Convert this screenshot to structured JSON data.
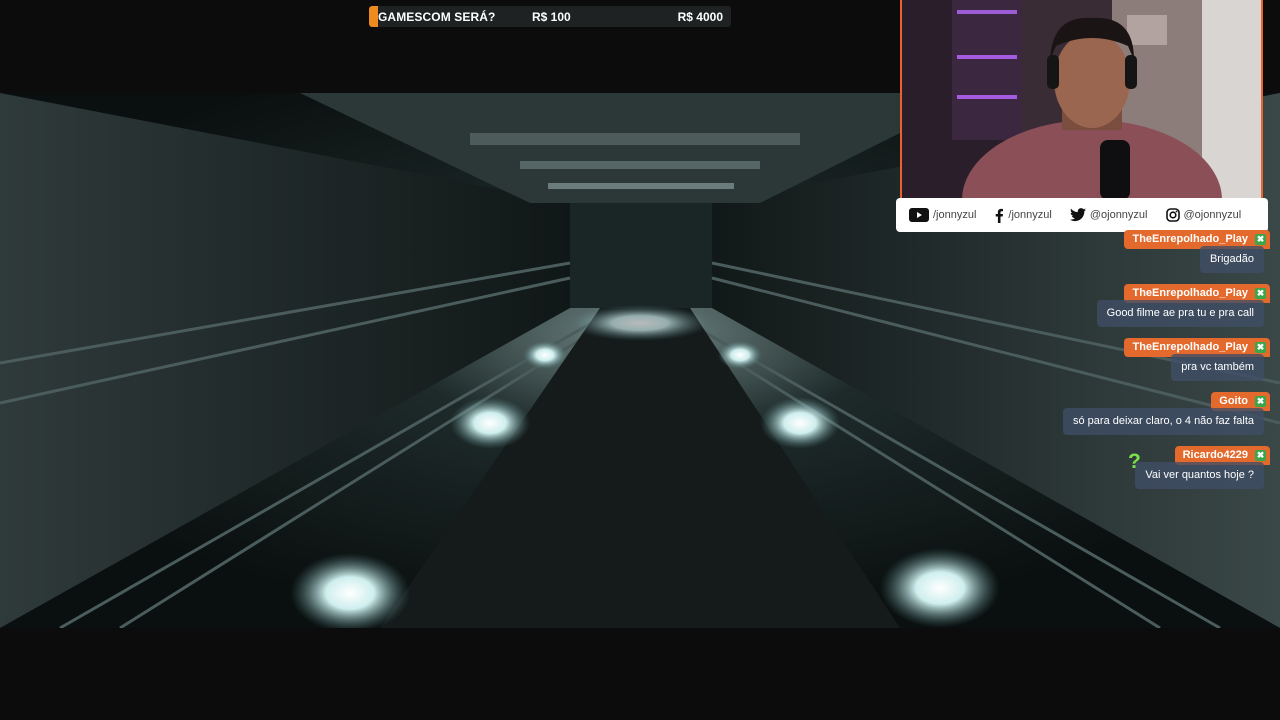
{
  "goal": {
    "title": "GAMESCOM SERÁ?",
    "current": "R$ 100",
    "target": "R$ 4000",
    "progress": 0.025,
    "accent": "#ef8a1e"
  },
  "socials": [
    {
      "icon": "youtube-icon",
      "label": "/jonnyzul"
    },
    {
      "icon": "facebook-icon",
      "label": "/jonnyzul"
    },
    {
      "icon": "twitter-icon",
      "label": "@ojonnyzul"
    },
    {
      "icon": "instagram-icon",
      "label": "@ojonnyzul"
    }
  ],
  "chat": [
    {
      "user": "TheEnrepolhado_Play",
      "message": "Brigadão"
    },
    {
      "user": "TheEnrepolhado_Play",
      "message": "Good filme ae pra tu e pra call"
    },
    {
      "user": "TheEnrepolhado_Play",
      "message": "pra vc também"
    },
    {
      "user": "Goito",
      "message": "só para deixar claro, o 4 não faz falta"
    },
    {
      "user": "Ricardo4229",
      "message": "Vai ver quantos hoje ?"
    }
  ],
  "chat_badge": "✖",
  "question_icon": "?",
  "colors": {
    "name_bg": "#e36a2c",
    "msg_bg": "#404e68",
    "cam_border": "#e8642c"
  }
}
